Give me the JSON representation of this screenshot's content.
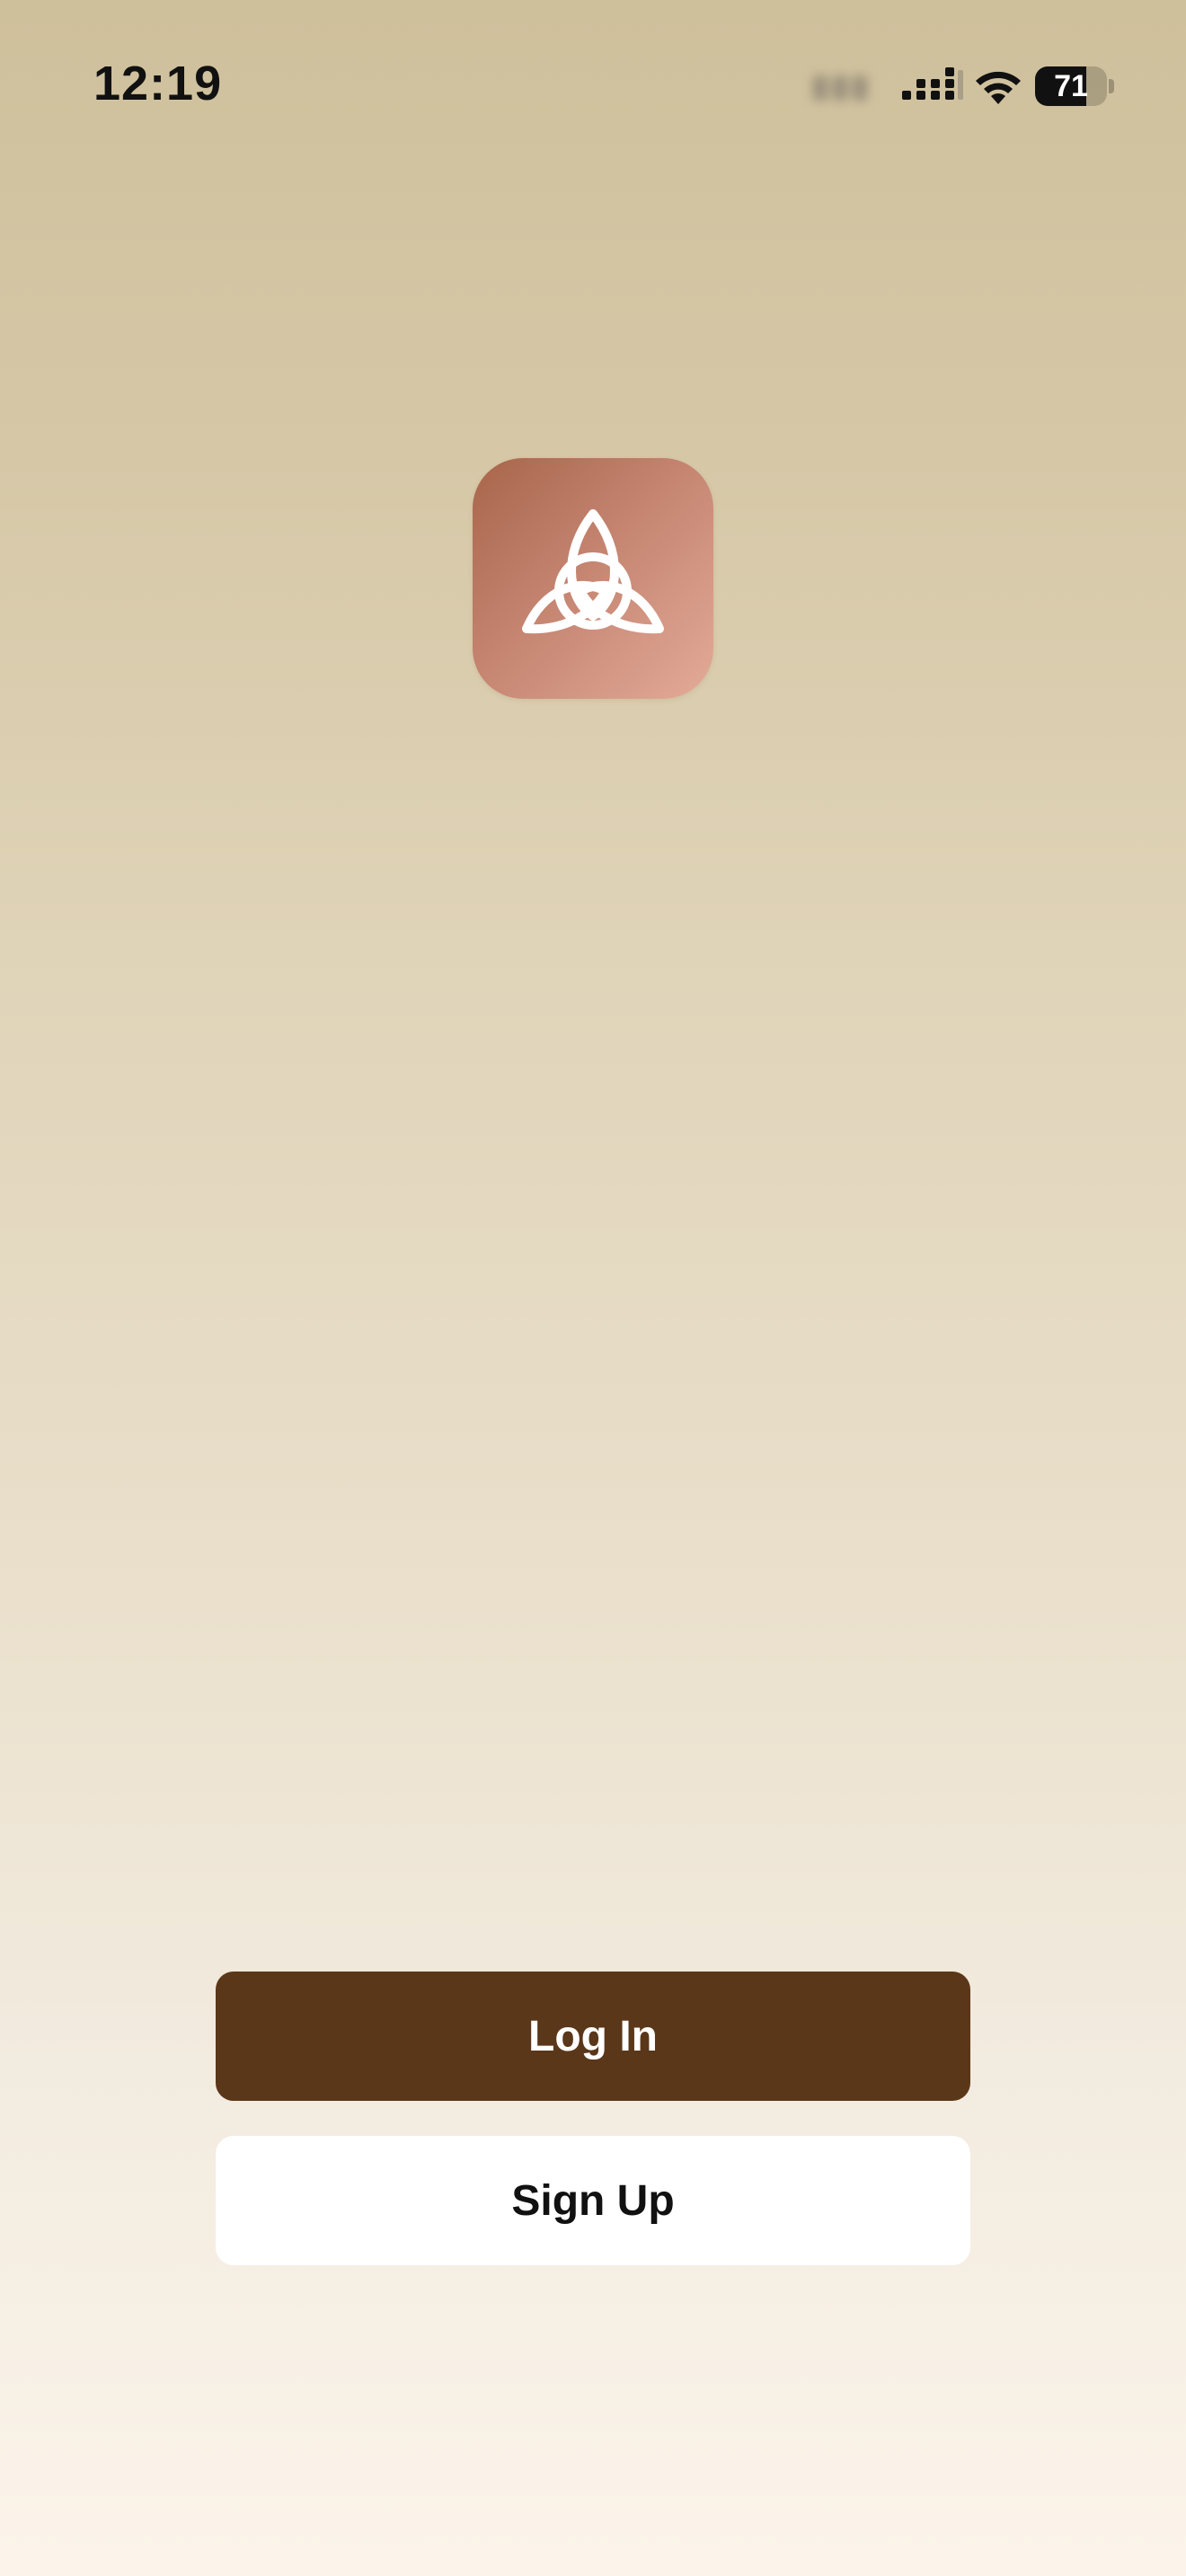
{
  "status_bar": {
    "time": "12:19",
    "battery_level": "71",
    "signal_icon": "cellular-signal-icon",
    "wifi_icon": "wifi-icon",
    "battery_icon": "battery-icon"
  },
  "app": {
    "logo_icon": "triquetra-icon",
    "logo_colors": [
      "#a8654b",
      "#e3ab98"
    ]
  },
  "actions": {
    "login_label": "Log In",
    "signup_label": "Sign Up"
  },
  "colors": {
    "primary_button": "#5a3719",
    "secondary_button": "#ffffff",
    "background_top": "#cfc09c",
    "background_bottom": "#fcf4ea"
  }
}
